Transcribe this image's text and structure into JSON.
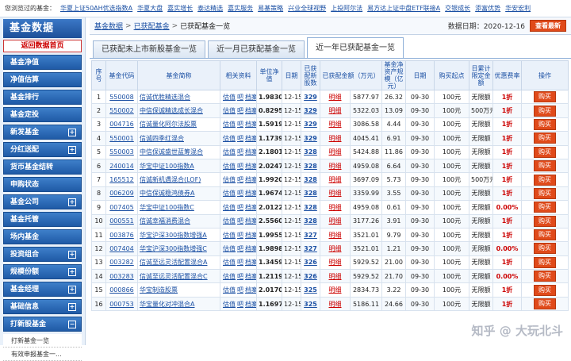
{
  "topbar": {
    "label": "您浏览过的基金：",
    "links": [
      "华夏上证50AH优选指数A",
      "华夏大盘",
      "嘉实增长",
      "泰达精选",
      "嘉实服务",
      "易基策略",
      "兴业全球视野",
      "上投阿尔法",
      "易方达上证中盘ETF联接A",
      "交银成长",
      "添富优势",
      "华安宏利"
    ]
  },
  "sidebar": {
    "logo": "基金数据",
    "home": "返回数据首页",
    "items": [
      {
        "label": "基金净值",
        "pm": ""
      },
      {
        "label": "净值估算",
        "pm": ""
      },
      {
        "label": "基金排行",
        "pm": ""
      },
      {
        "label": "基金定投",
        "pm": ""
      },
      {
        "label": "新发基金",
        "pm": "+"
      },
      {
        "label": "分红送配",
        "pm": "+"
      },
      {
        "label": "货币基金结转",
        "pm": ""
      },
      {
        "label": "申购状态",
        "pm": ""
      },
      {
        "label": "基金公司",
        "pm": "+"
      },
      {
        "label": "基金托管",
        "pm": ""
      },
      {
        "label": "场内基金",
        "pm": ""
      },
      {
        "label": "投资组合",
        "pm": "+"
      },
      {
        "label": "规模份额",
        "pm": "+"
      },
      {
        "label": "基金经理",
        "pm": "+"
      },
      {
        "label": "基础信息",
        "pm": "+"
      },
      {
        "label": "打新股基金",
        "pm": "−"
      }
    ],
    "sub": [
      "打新基金一览",
      "有效申报基金一..."
    ]
  },
  "breadcrumb": {
    "items": [
      "基金数据",
      "已获配基金",
      "已获配基金一览"
    ],
    "sep": ">",
    "date_label": "数据日期：2020-12-16",
    "new_button": "查看最新"
  },
  "tabs": [
    "已获配未上市新股基金一览",
    "近一月已获配基金一览",
    "近一年已获配基金一览"
  ],
  "table": {
    "headers": [
      "序号",
      "基金代码",
      "基金简称",
      "相关资料",
      "单位净值",
      "日期",
      "已获配新股数",
      "已获配金额（万元）",
      "基金净资产规模（亿元）",
      "日期",
      "购买起点",
      "日累计限定金额",
      "优惠费率",
      "操作"
    ],
    "link_labels": [
      "估值",
      "吧",
      "档案"
    ],
    "detail_label": "明细",
    "buy_label": "购买",
    "rows": [
      [
        "1",
        "550008",
        "信诚优胜精选混合",
        "1.9830",
        "12-15",
        "329",
        "5877.97",
        "26.32",
        "09-30",
        "100元",
        "无限额",
        "1折"
      ],
      [
        "2",
        "550002",
        "中信保诚精选成长混合",
        "0.8295",
        "12-15",
        "329",
        "5322.03",
        "13.09",
        "09-30",
        "100元",
        "500万元",
        "1折"
      ],
      [
        "3",
        "004716",
        "信诚量化阿尔法股票",
        "1.5919",
        "12-15",
        "329",
        "3086.58",
        "4.44",
        "09-30",
        "100元",
        "无限额",
        "1折"
      ],
      [
        "4",
        "550001",
        "信诚四季红混合",
        "1.1739",
        "12-15",
        "329",
        "4045.41",
        "6.91",
        "09-30",
        "100元",
        "无限额",
        "1折"
      ],
      [
        "5",
        "550003",
        "中信保诚盛世蓝筹混合",
        "2.1801",
        "12-15",
        "328",
        "5424.88",
        "11.86",
        "09-30",
        "100元",
        "无限额",
        "1折"
      ],
      [
        "6",
        "240014",
        "华宝中证100指数A",
        "2.0247",
        "12-15",
        "328",
        "4959.08",
        "6.64",
        "09-30",
        "100元",
        "无限额",
        "1折"
      ],
      [
        "7",
        "165512",
        "信诚新机遇混合(LOF)",
        "1.9920",
        "12-15",
        "328",
        "3697.09",
        "5.73",
        "09-30",
        "100元",
        "500万元",
        "1折"
      ],
      [
        "8",
        "006209",
        "中信保诚稳鸿债券A",
        "1.9674",
        "12-15",
        "328",
        "3359.99",
        "3.55",
        "09-30",
        "100元",
        "无限额",
        "1折"
      ],
      [
        "9",
        "007405",
        "华宝中证100指数C",
        "2.0122",
        "12-15",
        "328",
        "4959.08",
        "0.61",
        "09-30",
        "100元",
        "无限额",
        "0.00%"
      ],
      [
        "10",
        "000551",
        "信诚幸福消费混合",
        "2.5560",
        "12-15",
        "328",
        "3177.26",
        "3.91",
        "09-30",
        "100元",
        "无限额",
        "1折"
      ],
      [
        "11",
        "003876",
        "华宝沪深300指数增强A",
        "1.9955",
        "12-15",
        "327",
        "3521.01",
        "9.79",
        "09-30",
        "100元",
        "无限额",
        "1折"
      ],
      [
        "12",
        "007404",
        "华宝沪深300指数增强C",
        "1.9898",
        "12-15",
        "327",
        "3521.01",
        "1.21",
        "09-30",
        "100元",
        "无限额",
        "0.00%"
      ],
      [
        "13",
        "003282",
        "信诚至远灵活配置混合A",
        "1.3459",
        "12-15",
        "326",
        "5929.52",
        "21.00",
        "09-30",
        "100元",
        "无限额",
        "1折"
      ],
      [
        "14",
        "003283",
        "信诚至远灵活配置混合C",
        "1.2119",
        "12-15",
        "326",
        "5929.52",
        "21.70",
        "09-30",
        "100元",
        "无限额",
        "0.00%"
      ],
      [
        "15",
        "000866",
        "华宝制造股票",
        "2.0170",
        "12-15",
        "325",
        "2834.73",
        "3.22",
        "09-30",
        "100元",
        "无限额",
        "1折"
      ],
      [
        "16",
        "000753",
        "华宝量化对冲混合A",
        "1.1697",
        "12-15",
        "325",
        "5186.11",
        "24.66",
        "09-30",
        "100元",
        "无限额",
        "1折"
      ]
    ]
  },
  "watermark": "知乎 @ 大玩北斗"
}
